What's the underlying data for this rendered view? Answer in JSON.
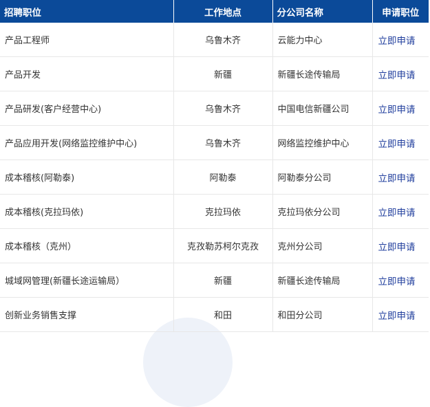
{
  "table": {
    "headers": {
      "position": "招聘职位",
      "location": "工作地点",
      "branch": "分公司名称",
      "apply": "申请职位"
    },
    "rows": [
      {
        "position": "产品工程师",
        "location": "乌鲁木齐",
        "branch": "云能力中心",
        "apply": "立即申请"
      },
      {
        "position": "产品开发",
        "location": "新疆",
        "branch": "新疆长途传输局",
        "apply": "立即申请"
      },
      {
        "position": "产品研发(客户经营中心)",
        "location": "乌鲁木齐",
        "branch": "中国电信新疆公司",
        "apply": "立即申请"
      },
      {
        "position": "产品应用开发(网络监控维护中心)",
        "location": "乌鲁木齐",
        "branch": "网络监控维护中心",
        "apply": "立即申请"
      },
      {
        "position": "成本稽核(阿勒泰)",
        "location": "阿勒泰",
        "branch": "阿勒泰分公司",
        "apply": "立即申请"
      },
      {
        "position": "成本稽核(克拉玛依)",
        "location": "克拉玛依",
        "branch": "克拉玛依分公司",
        "apply": "立即申请"
      },
      {
        "position": "成本稽核（克州）",
        "location": "克孜勒苏柯尔克孜",
        "branch": "克州分公司",
        "apply": "立即申请"
      },
      {
        "position": "城域网管理(新疆长途运输局）",
        "location": "新疆",
        "branch": "新疆长途传输局",
        "apply": "立即申请"
      },
      {
        "position": "创新业务销售支撑",
        "location": "和田",
        "branch": "和田分公司",
        "apply": "立即申请"
      }
    ]
  },
  "colors": {
    "header_bg": "#0b4a99",
    "header_text": "#ffffff",
    "link": "#1e3c9c",
    "border": "#e7e7e7"
  }
}
